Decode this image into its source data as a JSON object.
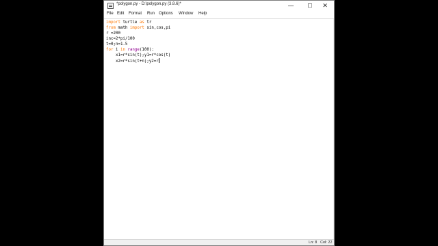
{
  "window": {
    "title": "*polygon.py - D:\\polygon.py (3.8.6)*",
    "minimize_glyph": "—",
    "maximize_glyph": "☐",
    "close_glyph": "✕"
  },
  "menu": {
    "items": [
      "File",
      "Edit",
      "Format",
      "Run",
      "Options",
      "Window",
      "Help"
    ]
  },
  "editor": {
    "lines": [
      [
        {
          "t": "import",
          "c": "kw"
        },
        {
          "t": " turtle "
        },
        {
          "t": "as",
          "c": "kw"
        },
        {
          "t": " tr"
        }
      ],
      [
        {
          "t": "from",
          "c": "kw"
        },
        {
          "t": " math "
        },
        {
          "t": "import",
          "c": "kw"
        },
        {
          "t": " sin,cos,pi"
        }
      ],
      [
        {
          "t": "r =200"
        }
      ],
      [
        {
          "t": "inc=2*pi/100"
        }
      ],
      [
        {
          "t": "t=0;n=1.5"
        }
      ],
      [
        {
          "t": "for",
          "c": "kw"
        },
        {
          "t": " i "
        },
        {
          "t": "in",
          "c": "kw"
        },
        {
          "t": " "
        },
        {
          "t": "range",
          "c": "bi"
        },
        {
          "t": "(100):"
        }
      ],
      [
        {
          "t": "    x1=r*sin(t);y1=r*cos(t)"
        }
      ],
      [
        {
          "t": "    x2=r*sin(t+n);y2=r"
        }
      ]
    ]
  },
  "status": {
    "line": "Ln: 8",
    "col": "Col: 22"
  },
  "colors": {
    "keyword": "#ff7700",
    "builtin": "#900090",
    "text": "#000000"
  }
}
